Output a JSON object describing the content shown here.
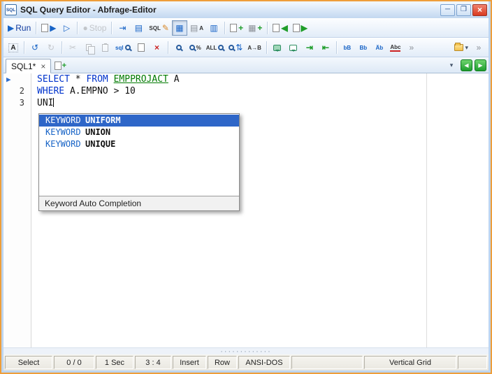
{
  "window": {
    "title": "SQL Query Editor - Abfrage-Editor"
  },
  "icons": {
    "app": "SQL",
    "minimize": "─",
    "maximize": "❐",
    "close": "×",
    "run": "▶",
    "run_script": "▶",
    "step_run": "▷",
    "stop": "●",
    "run_to_cursor": "⇥",
    "explain_plan": "▤",
    "sql_builder": "SQL",
    "pencil": "✎",
    "grid_view": "▦",
    "text_view_grid": "▤",
    "text_view_a": "A",
    "chart_view": "▥",
    "plus": "+",
    "nav_left_small": "◀",
    "nav_right_small": "▶",
    "font": "A",
    "undo": "↺",
    "redo": "↻",
    "cut": "✂",
    "sql_small": "sql",
    "delete": "×",
    "percent": "%",
    "all": "ALL",
    "updown": "⇅",
    "replace": "A→B",
    "indent": "⇥",
    "outdent": "⇤",
    "lowercase": "bB",
    "uppercase": "Bb",
    "umlaut": "Äb",
    "spellcase": "Abc",
    "chevron": "»",
    "dropdown": "▾",
    "tab_close": "×",
    "nav_left": "◀",
    "nav_right": "▶",
    "grip": "·············"
  },
  "toolbar1": {
    "run_label": "Run",
    "stop_label": "Stop"
  },
  "tabs": {
    "active": "SQL1*"
  },
  "editor": {
    "marker": "▶",
    "line_numbers": [
      "",
      "2",
      "3"
    ],
    "code": {
      "l1_kw1": "SELECT",
      "l1_p1": " * ",
      "l1_kw2": "FROM",
      "l1_p2": " ",
      "l1_obj": "EMPPROJACT",
      "l1_p3": " A",
      "l2_kw": "WHERE",
      "l2_p": " A.EMPNO > 10",
      "l3_p": "UNI"
    }
  },
  "autocomplete": {
    "items": [
      {
        "type": "KEYWORD",
        "value": "UNIFORM"
      },
      {
        "type": "KEYWORD",
        "value": "UNION"
      },
      {
        "type": "KEYWORD",
        "value": "UNIQUE"
      }
    ],
    "footer": "Keyword Auto Completion"
  },
  "statusbar": {
    "segments": [
      "Select",
      "0 / 0",
      "1 Sec",
      "3 : 4",
      "Insert",
      "Row",
      "ANSI-DOS",
      "",
      "Vertical Grid",
      ""
    ]
  }
}
